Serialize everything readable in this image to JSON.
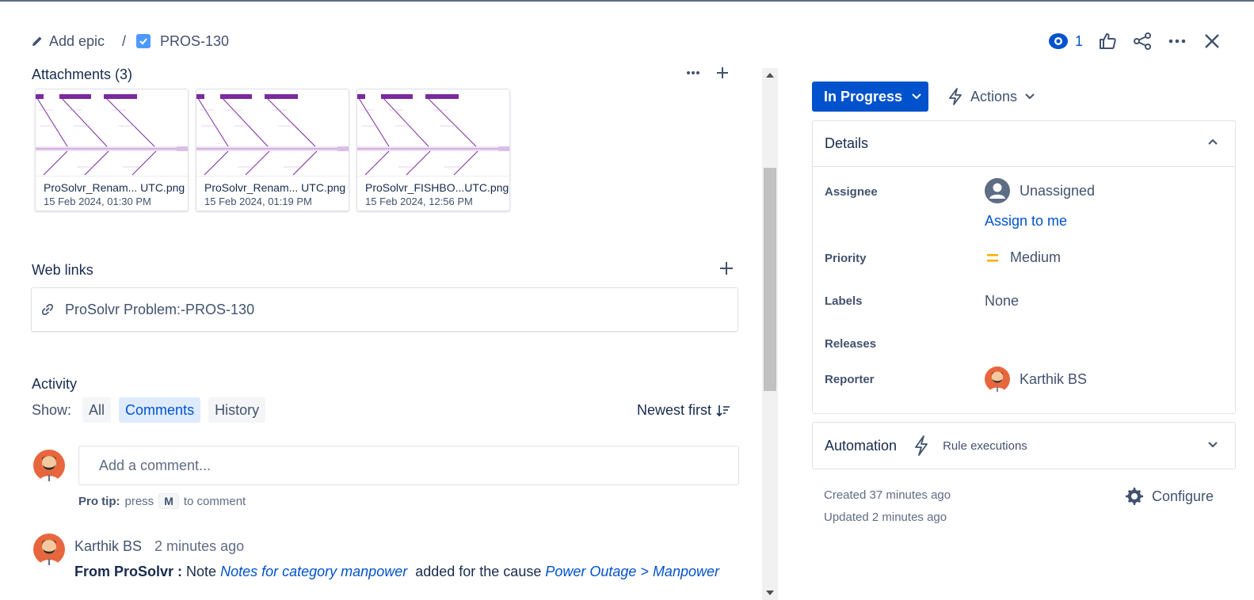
{
  "header": {
    "add_epic": "Add epic",
    "separator": "/",
    "issue_key": "PROS-130",
    "watch_count": "1"
  },
  "attachments": {
    "title": "Attachments (3)",
    "items": [
      {
        "name": "ProSolvr_Renam... UTC.png",
        "date": "15 Feb 2024, 01:30 PM"
      },
      {
        "name": "ProSolvr_Renam... UTC.png",
        "date": "15 Feb 2024, 01:19 PM"
      },
      {
        "name": "ProSolvr_FISHBO...UTC.png",
        "date": "15 Feb 2024, 12:56 PM"
      }
    ]
  },
  "web_links": {
    "title": "Web links",
    "items": [
      {
        "text": "ProSolvr Problem:-PROS-130"
      }
    ]
  },
  "activity": {
    "title": "Activity",
    "show_label": "Show:",
    "filters": [
      "All",
      "Comments",
      "History"
    ],
    "active_filter": "Comments",
    "sort_label": "Newest first",
    "comment_placeholder": "Add a comment...",
    "pro_tip_label": "Pro tip:",
    "pro_tip_press": "press",
    "pro_tip_key": "M",
    "pro_tip_suffix": "to comment",
    "comments": [
      {
        "author": "Karthik BS",
        "time": "2 minutes ago",
        "prefix": "From ProSolvr :",
        "text1": "Note",
        "note": "Notes for category manpower",
        "text2": "added for the cause",
        "cause": "Power Outage > Manpower"
      }
    ]
  },
  "sidebar": {
    "status": "In Progress",
    "actions": "Actions",
    "details_title": "Details",
    "fields": {
      "assignee_label": "Assignee",
      "assignee_value": "Unassigned",
      "assign_to_me": "Assign to me",
      "priority_label": "Priority",
      "priority_value": "Medium",
      "labels_label": "Labels",
      "labels_value": "None",
      "releases_label": "Releases",
      "reporter_label": "Reporter",
      "reporter_value": "Karthik BS"
    },
    "automation_title": "Automation",
    "rule_executions": "Rule executions",
    "created": "Created 37 minutes ago",
    "updated": "Updated 2 minutes ago",
    "configure": "Configure"
  },
  "colors": {
    "primary": "#0052cc",
    "priority_medium": "#ffab00",
    "avatar_bg": "#e8663d",
    "diagram_purple": "#7b2a9e"
  }
}
